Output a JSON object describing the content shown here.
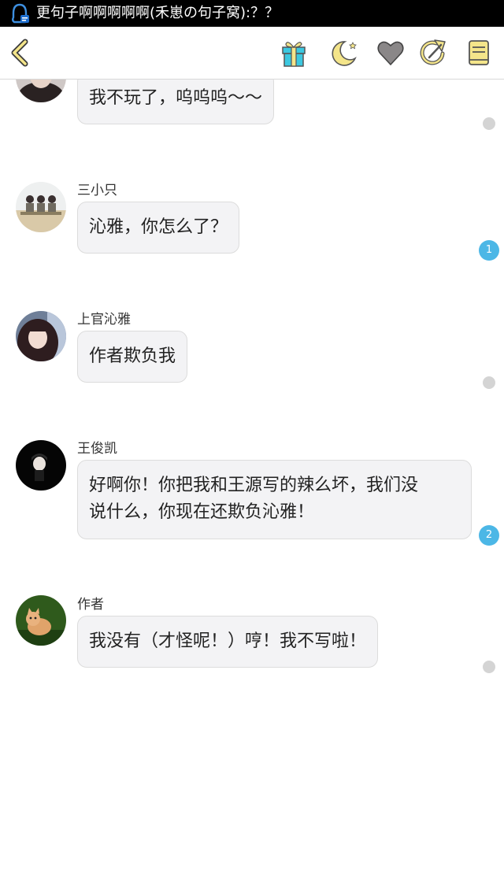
{
  "status_bar": {
    "app_icon": "qq-penguin-icon",
    "notification_text": "更句子啊啊啊啊啊(禾崽の句子窝):？？"
  },
  "toolbar": {
    "back_icon": "chevron-left-icon",
    "actions": [
      {
        "name": "gift-icon",
        "color": "#3cc8e0"
      },
      {
        "name": "moon-icon",
        "color": "#f4e58a"
      },
      {
        "name": "heart-icon",
        "color": "#8a8788"
      },
      {
        "name": "share-icon",
        "color": "#f4e58a"
      },
      {
        "name": "book-icon",
        "color": "#f4e58a"
      }
    ]
  },
  "messages": [
    {
      "sender": "",
      "text": "我不玩了，呜呜呜～～",
      "badge": ""
    },
    {
      "sender": "三小只",
      "text": "沁雅，你怎么了？",
      "badge": "1"
    },
    {
      "sender": "上官沁雅",
      "text": "作者欺负我",
      "badge": ""
    },
    {
      "sender": "王俊凯",
      "lines": [
        "好啊你！你把我和王源写的辣么坏，我们没",
        "说什么，你现在还欺负沁雅！"
      ],
      "badge": "2"
    },
    {
      "sender": "作者",
      "text": "我没有（才怪呢！）哼！我不写啦！",
      "badge": ""
    }
  ],
  "colors": {
    "bubble_bg": "#f3f3f5",
    "badge": "#4cb7e6",
    "read_dot": "#d4d4d4",
    "icon_yellow": "#f4e58a"
  }
}
